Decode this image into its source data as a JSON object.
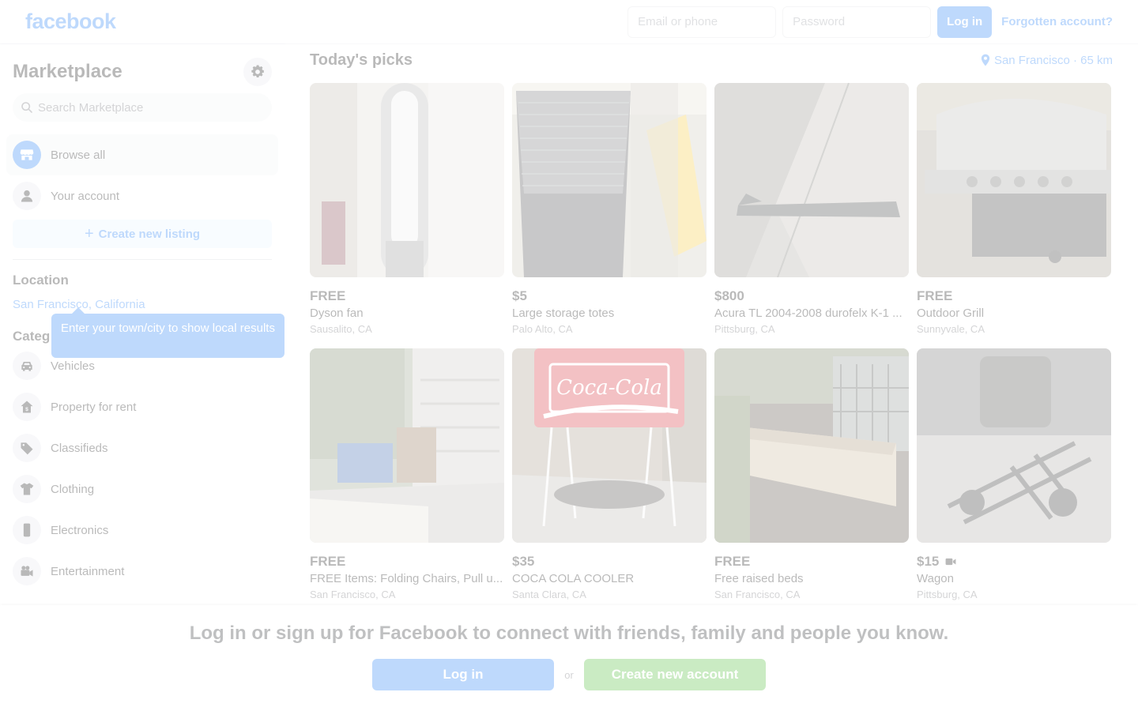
{
  "topbar": {
    "logo": "facebook",
    "email_placeholder": "Email or phone",
    "password_placeholder": "Password",
    "login_label": "Log in",
    "forgot_label": "Forgotten account?"
  },
  "sidebar": {
    "title": "Marketplace",
    "search_placeholder": "Search Marketplace",
    "nav": [
      {
        "label": "Browse all",
        "icon": "storefront-icon"
      },
      {
        "label": "Your account",
        "icon": "person-icon"
      }
    ],
    "create_label": "Create new listing",
    "location_title": "Location",
    "location_value": "San Francisco, California",
    "tooltip": "Enter your town/city to show local results",
    "categories_title": "Categ",
    "categories": [
      {
        "label": "Vehicles",
        "icon": "car-icon"
      },
      {
        "label": "Property for rent",
        "icon": "house-icon"
      },
      {
        "label": "Classifieds",
        "icon": "tag-icon"
      },
      {
        "label": "Clothing",
        "icon": "shirt-icon"
      },
      {
        "label": "Electronics",
        "icon": "phone-icon"
      },
      {
        "label": "Entertainment",
        "icon": "camera-icon"
      }
    ]
  },
  "main": {
    "title": "Today's picks",
    "location_filter": "San Francisco · 65 km",
    "listings": [
      {
        "price": "FREE",
        "title": "Dyson fan",
        "location": "Sausalito, CA"
      },
      {
        "price": "$5",
        "title": "Large storage totes",
        "location": "Palo Alto, CA"
      },
      {
        "price": "$800",
        "title": "Acura TL 2004-2008 durofelx K-1 ...",
        "location": "Pittsburg, CA"
      },
      {
        "price": "FREE",
        "title": "Outdoor Grill",
        "location": "Sunnyvale, CA"
      },
      {
        "price": "FREE",
        "title": "FREE Items: Folding Chairs, Pull u...",
        "location": "San Francisco, CA"
      },
      {
        "price": "$35",
        "title": "COCA COLA COOLER",
        "location": "Santa Clara, CA",
        "photo_text": "Coca-Cola"
      },
      {
        "price": "FREE",
        "title": "Free raised beds",
        "location": "San Francisco, CA"
      },
      {
        "price": "$15",
        "title": "Wagon",
        "location": "Pittsburg, CA",
        "badge_icon": "video-icon"
      }
    ]
  },
  "bottom": {
    "text": "Log in or sign up for Facebook to connect with friends, family and people you know.",
    "login_label": "Log in",
    "or_label": "or",
    "create_label": "Create new account"
  },
  "colors": {
    "brand": "#1877f2",
    "create_account": "#42b72a",
    "background": "#ffffff",
    "secondary_text": "#65676b"
  }
}
